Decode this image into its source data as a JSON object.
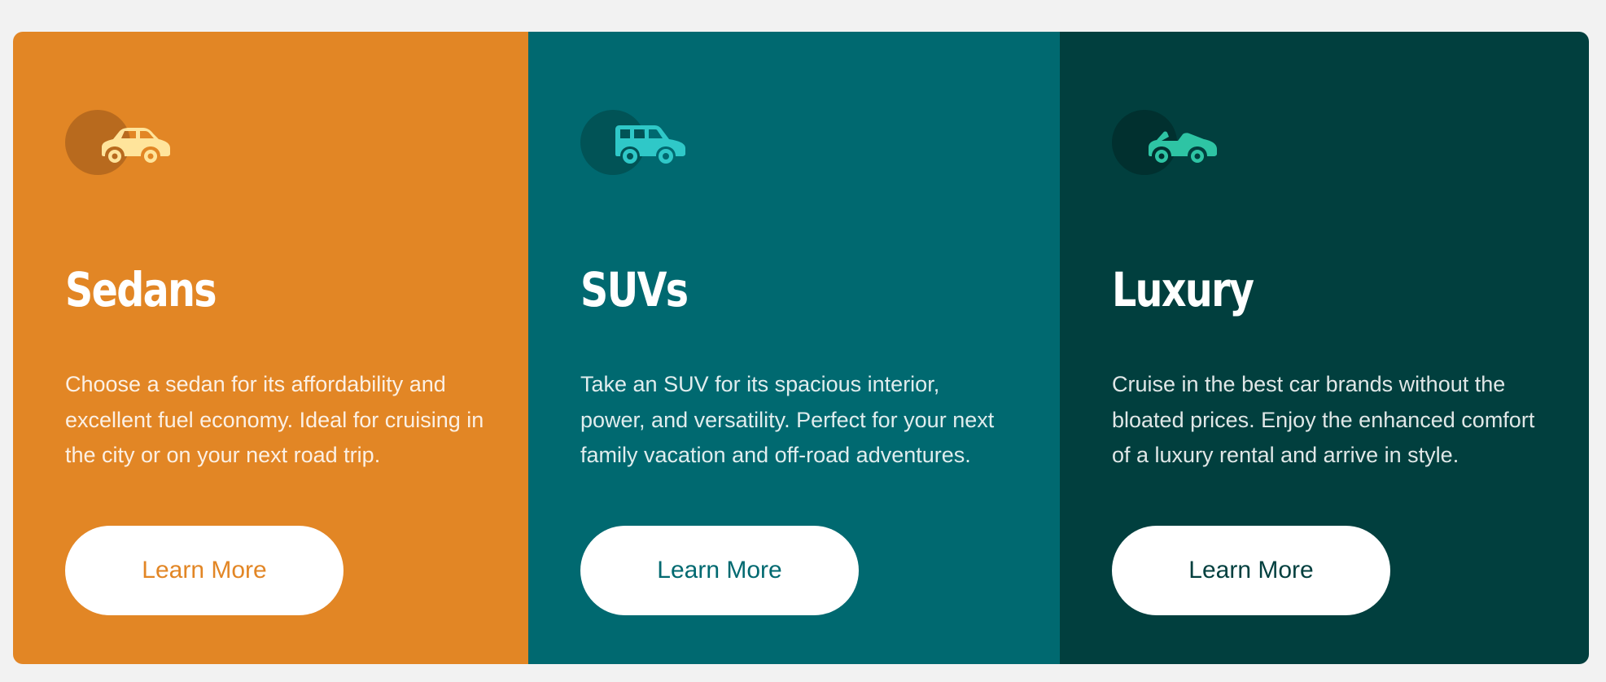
{
  "cards": [
    {
      "title": "Sedans",
      "description": "Choose a sedan for its affordability and excellent fuel economy. Ideal for cruising in the city or on your next road trip.",
      "button_label": "Learn More",
      "icon": "sedan-car-icon",
      "background_color": "#e28625",
      "icon_color": "#ffe49b"
    },
    {
      "title": "SUVs",
      "description": "Take an SUV for its spacious interior, power, and versatility. Perfect for your next family vacation and off-road adventures.",
      "button_label": "Learn More",
      "icon": "suv-car-icon",
      "background_color": "#006970",
      "icon_color": "#2fc8c8"
    },
    {
      "title": "Luxury",
      "description": "Cruise in the best car brands without the bloated prices. Enjoy the enhanced comfort of a luxury rental and arrive in style.",
      "button_label": "Learn More",
      "icon": "luxury-car-icon",
      "background_color": "#013f3e",
      "icon_color": "#2ec4a4"
    }
  ]
}
